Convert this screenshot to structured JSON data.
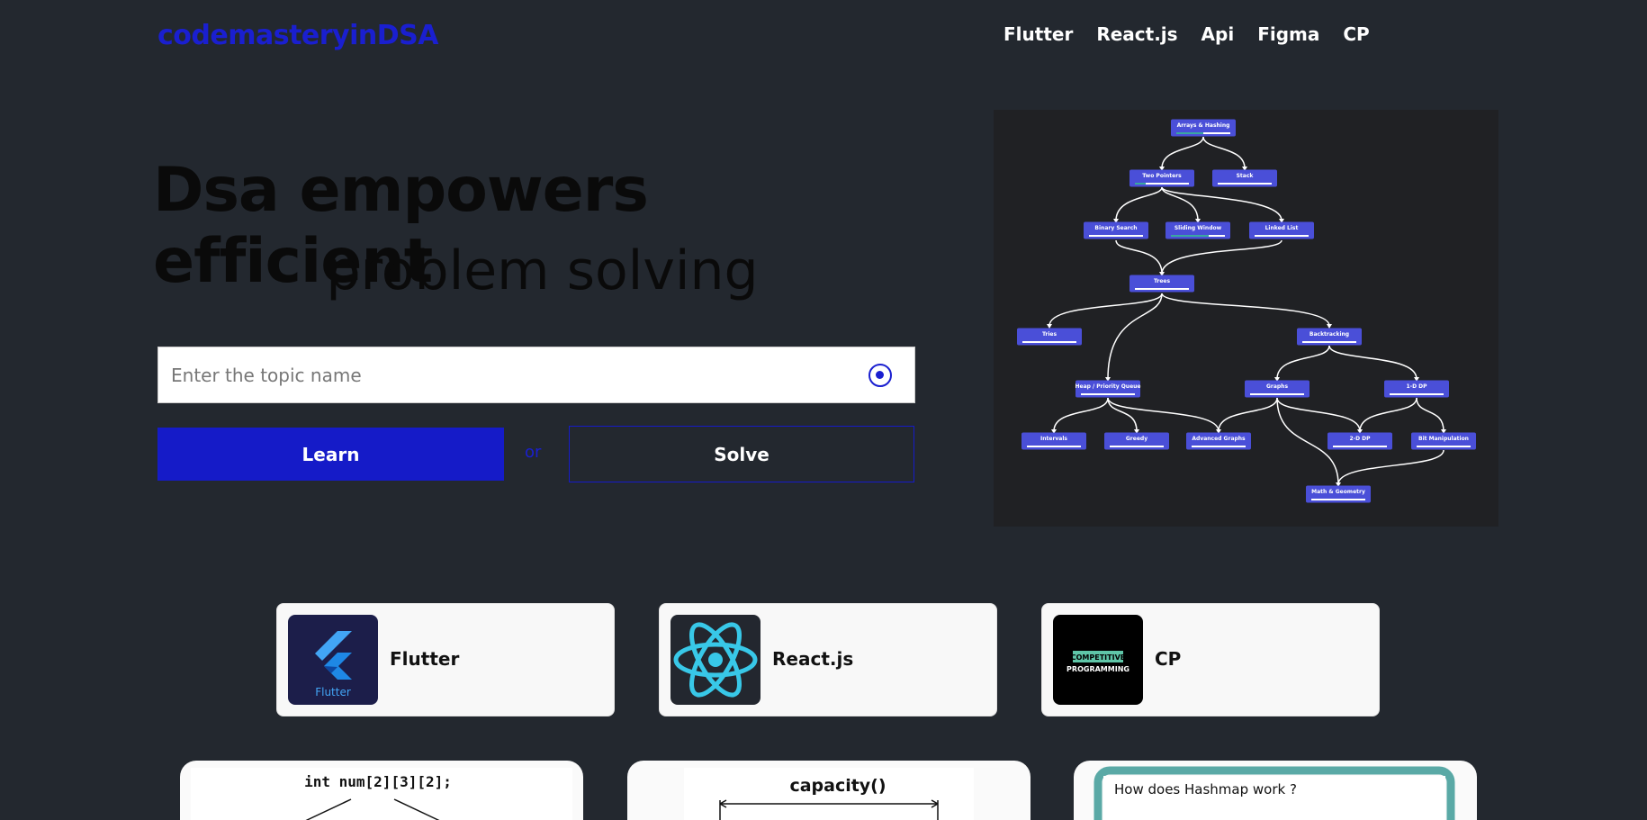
{
  "brand": "codemasteryinDSA",
  "nav": [
    "Flutter",
    "React.js",
    "Api",
    "Figma",
    "CP"
  ],
  "hero": {
    "title": "Dsa empowers efficient",
    "subtitle": "problem solving"
  },
  "search": {
    "placeholder": "Enter the topic name",
    "value": ""
  },
  "actions": {
    "learn": "Learn",
    "or": "or",
    "solve": "Solve"
  },
  "roadmap": {
    "nodes": [
      "Arrays & Hashing",
      "Two Pointers",
      "Stack",
      "Binary Search",
      "Sliding Window",
      "Linked List",
      "Trees",
      "Tries",
      "Backtracking",
      "Heap / Priority Queue",
      "Graphs",
      "1-D DP",
      "Intervals",
      "Greedy",
      "Advanced Graphs",
      "2-D DP",
      "Bit Manipulation",
      "Math & Geometry"
    ]
  },
  "categories": [
    {
      "label": "Flutter",
      "thumb_caption": "Flutter",
      "icon": "flutter-logo-icon"
    },
    {
      "label": "React.js",
      "icon": "react-logo-icon"
    },
    {
      "label": "CP",
      "thumb_lines": [
        "COMPETITIVE",
        "PROGRAMMING"
      ],
      "icon": "cp-logo-icon"
    }
  ],
  "previews": [
    {
      "text": "int num[2][3][2];"
    },
    {
      "text": "capacity()"
    },
    {
      "text": "How does Hashmap work ?"
    }
  ],
  "colors": {
    "accent": "#151bc8",
    "background": "#23282f",
    "node": "#4a4fd8"
  }
}
